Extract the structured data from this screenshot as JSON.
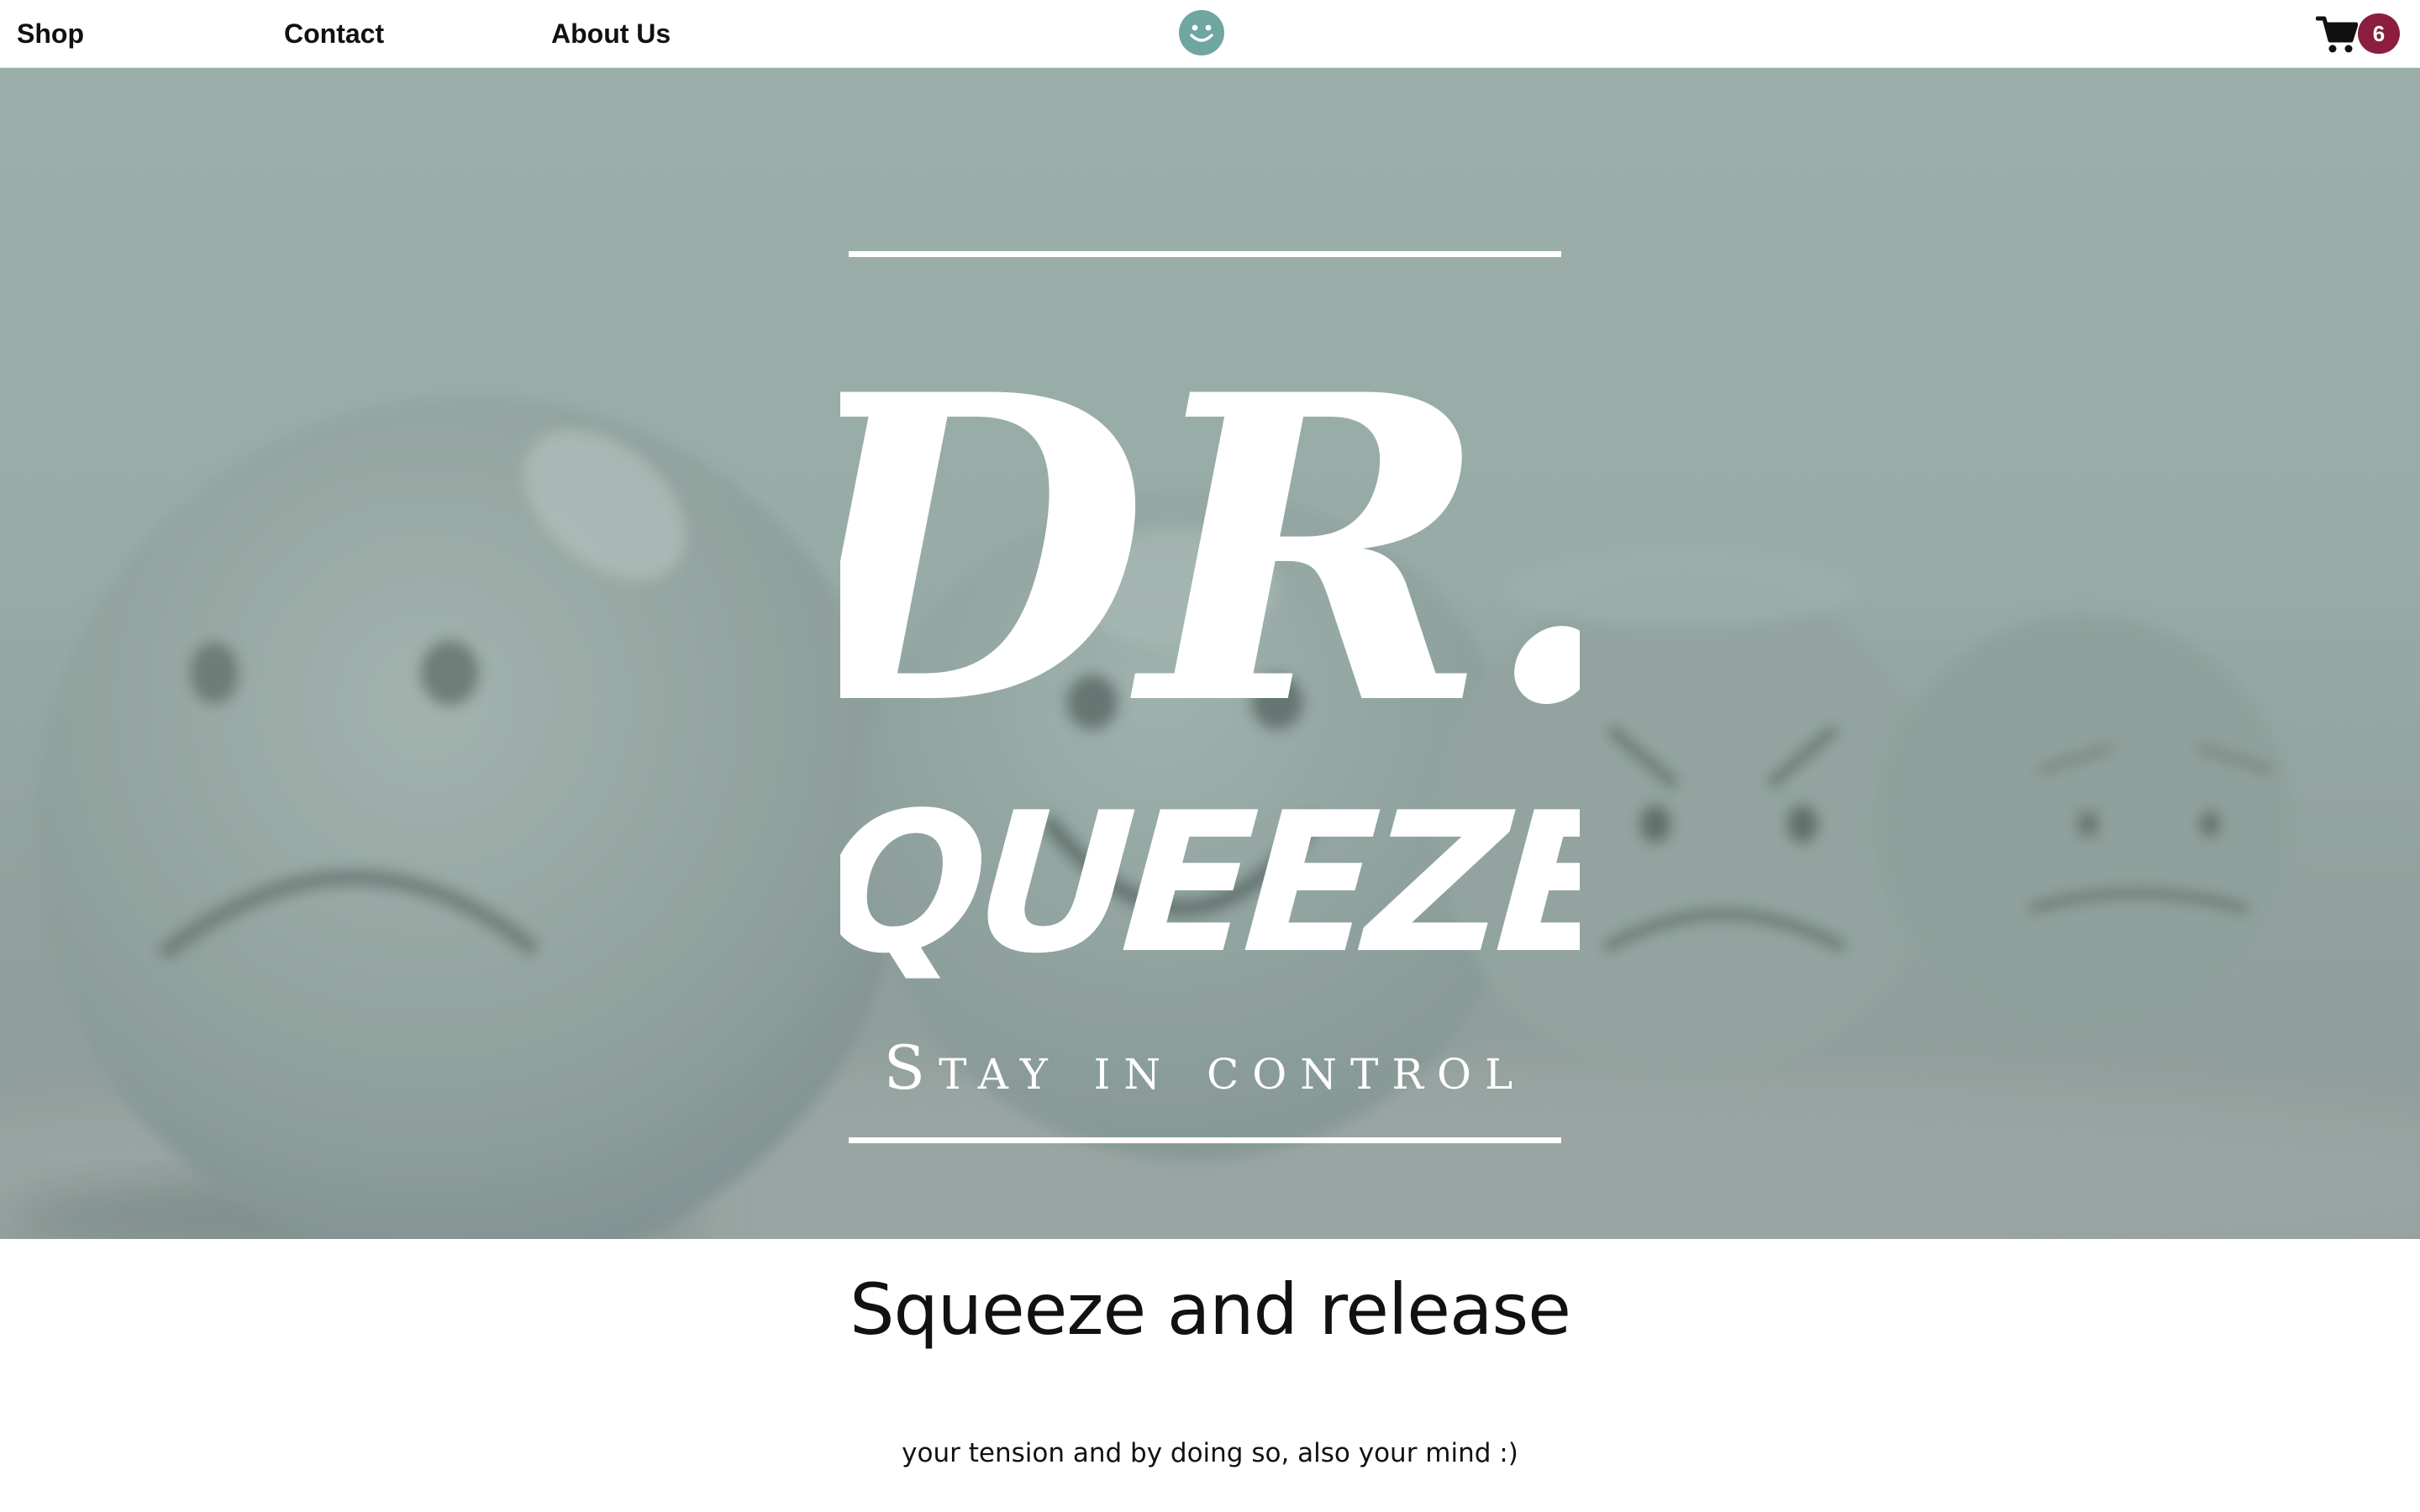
{
  "nav": {
    "items": [
      {
        "label": "Shop"
      },
      {
        "label": "Contact"
      },
      {
        "label": "About Us"
      }
    ],
    "logo_icon": "smiley-face-icon",
    "cart": {
      "icon": "shopping-cart-icon",
      "count": "6"
    }
  },
  "hero": {
    "logo_line1": "DR.",
    "logo_line2": "SQUEEZE",
    "tagline": "Stay in control",
    "background": "blurred-emoji-stress-balls"
  },
  "content": {
    "headline": "Squeeze and release",
    "subtext": "your tension and by doing so, also your mind :)"
  },
  "colors": {
    "accent": "#8b1e3f",
    "teal": "#6fa6a1",
    "hero_tint": "#9aaeaa"
  }
}
